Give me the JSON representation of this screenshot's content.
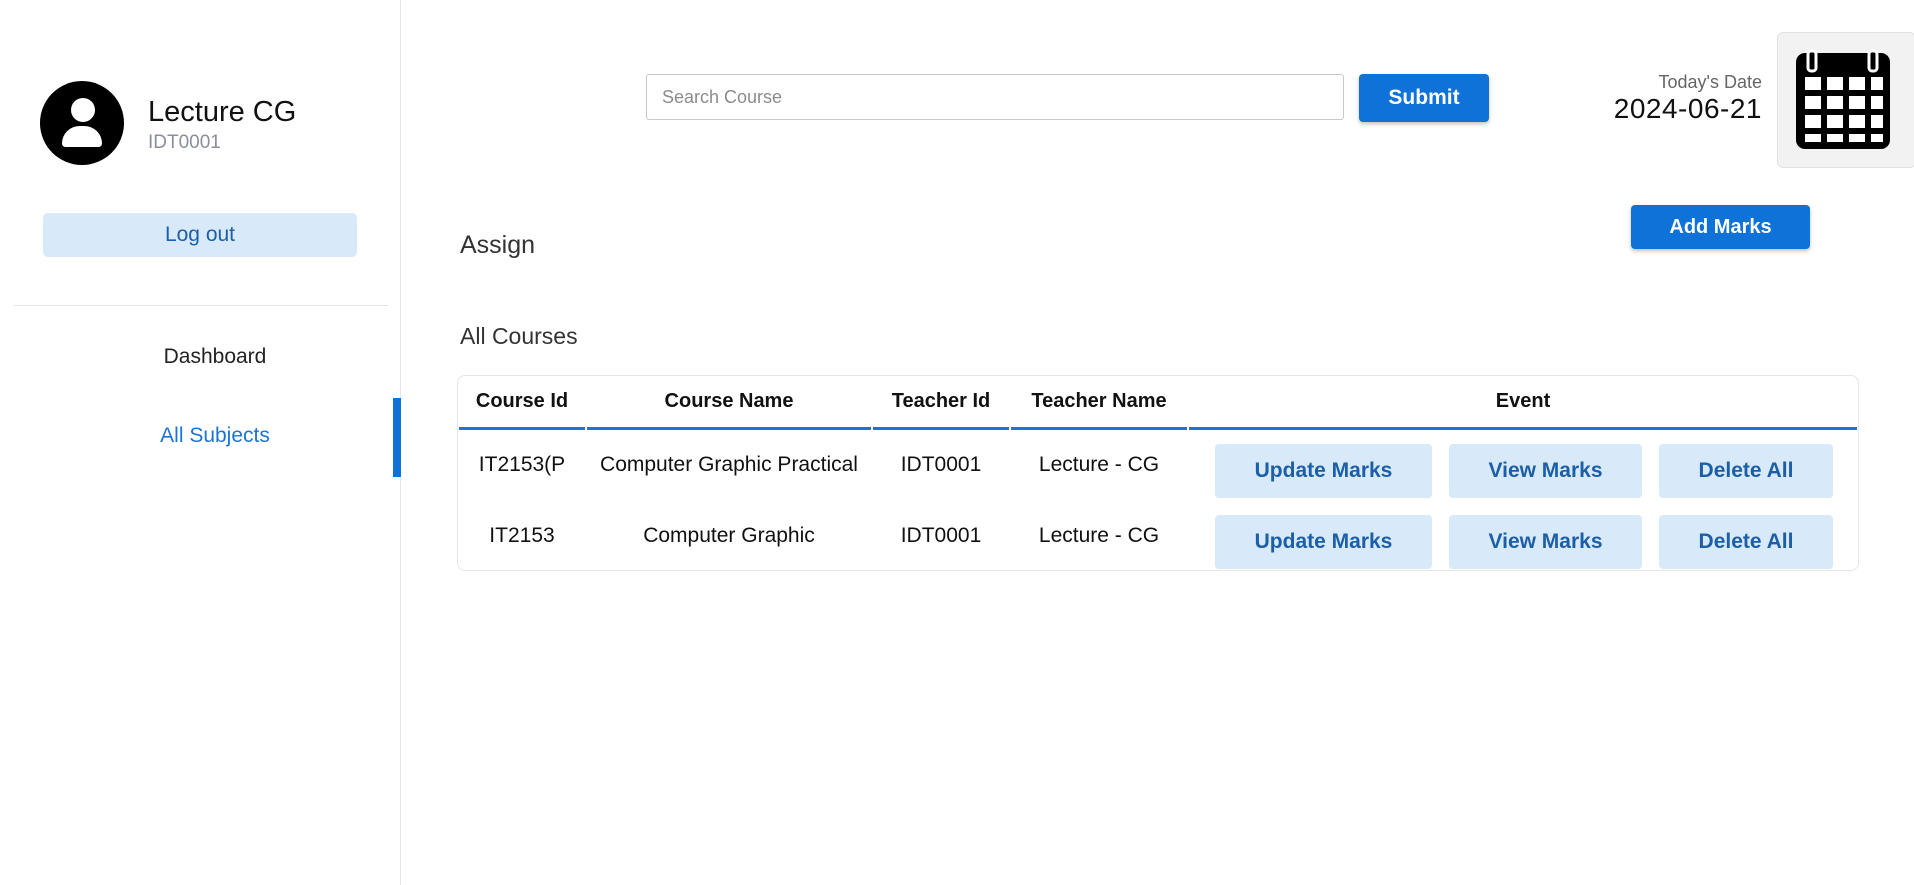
{
  "profile": {
    "name": "Lecture CG",
    "id": "IDT0001"
  },
  "sidebar": {
    "logout_label": "Log out",
    "nav": [
      {
        "label": "Dashboard"
      },
      {
        "label": "All Subjects",
        "active": true
      }
    ]
  },
  "search": {
    "placeholder": "Search Course",
    "value": "",
    "submit_label": "Submit"
  },
  "date": {
    "label": "Today's Date",
    "value": "2024-06-21",
    "icon": "calendar-icon"
  },
  "main": {
    "section_title": "Assign",
    "add_marks_label": "Add Marks",
    "table_title": "All Courses"
  },
  "table": {
    "headers": [
      "Course Id",
      "Course Name",
      "Teacher Id",
      "Teacher Name",
      "Event"
    ],
    "rows": [
      {
        "course_id": "IT2153(P",
        "course_name": "Computer Graphic Practical",
        "teacher_id": "IDT0001",
        "teacher_name": "Lecture - CG",
        "actions": {
          "update": "Update Marks",
          "view": "View Marks",
          "delete": "Delete All"
        }
      },
      {
        "course_id": "IT2153",
        "course_name": "Computer Graphic",
        "teacher_id": "IDT0001",
        "teacher_name": "Lecture - CG",
        "actions": {
          "update": "Update Marks",
          "view": "View Marks",
          "delete": "Delete All"
        }
      }
    ]
  },
  "colors": {
    "primary": "#0f72d9",
    "light_button": "#d8e9f9",
    "light_button_text": "#1b5fa8",
    "active_nav": "#1c75d4"
  }
}
